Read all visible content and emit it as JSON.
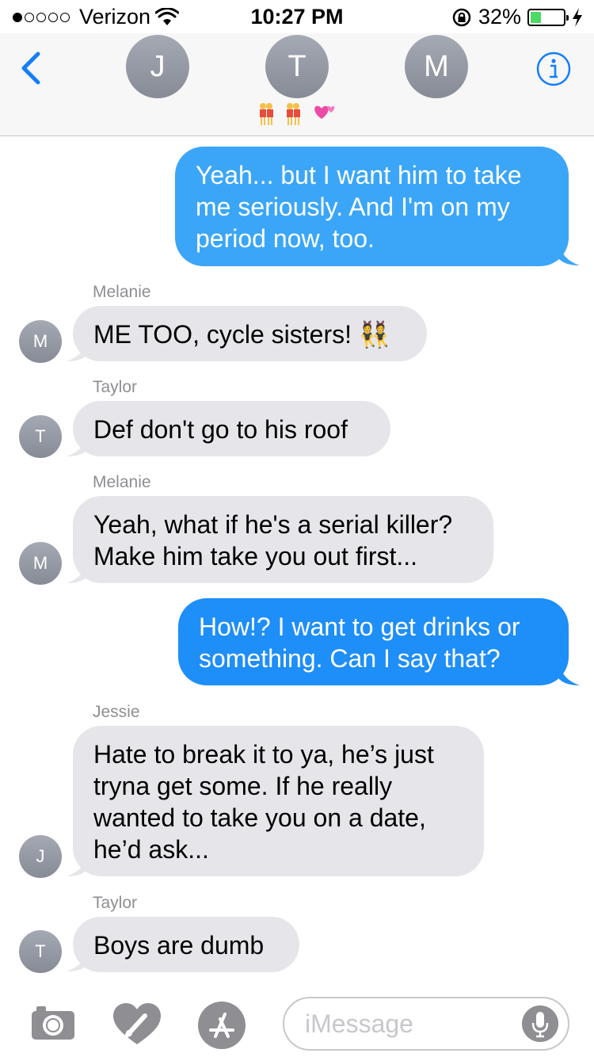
{
  "status_bar": {
    "carrier": "Verizon",
    "time": "10:27 PM",
    "battery_percent": "32%",
    "battery_level": 0.32,
    "signal_bars_filled": 1,
    "signal_bars_total": 5
  },
  "header": {
    "back_icon": "chevron-left-icon",
    "participants": [
      "J",
      "T",
      "M"
    ],
    "group_emoji": "👯👯💕",
    "info_icon": "info-icon"
  },
  "messages": [
    {
      "type": "outgoing",
      "text": "Yeah... but I want him to take me seriously. And I'm on my period now, too."
    },
    {
      "type": "incoming",
      "sender": "Melanie",
      "initial": "M",
      "text": "ME TOO, cycle sisters! 👯"
    },
    {
      "type": "incoming",
      "sender": "Taylor",
      "initial": "T",
      "text": "Def don't go to his roof"
    },
    {
      "type": "incoming",
      "sender": "Melanie",
      "initial": "M",
      "text": "Yeah, what if he's a serial killer? Make him take you out first..."
    },
    {
      "type": "outgoing",
      "text": "How!? I want to get drinks or something. Can I say that?"
    },
    {
      "type": "incoming",
      "sender": "Jessie",
      "initial": "J",
      "text": "Hate to break it to ya, he’s just tryna get some. If he really wanted to take you on a date, he’d ask..."
    },
    {
      "type": "incoming",
      "sender": "Taylor",
      "initial": "T",
      "text": "Boys are dumb"
    }
  ],
  "input_bar": {
    "placeholder": "iMessage",
    "icons": [
      "camera-icon",
      "digital-touch-icon",
      "app-store-icon",
      "microphone-icon"
    ]
  },
  "colors": {
    "outgoing_bubble": "#3ba6f7",
    "outgoing_bubble_latest": "#1e8ef8",
    "incoming_bubble": "#e5e5ea",
    "accent": "#147efb",
    "avatar_gray": "#8e919b"
  }
}
